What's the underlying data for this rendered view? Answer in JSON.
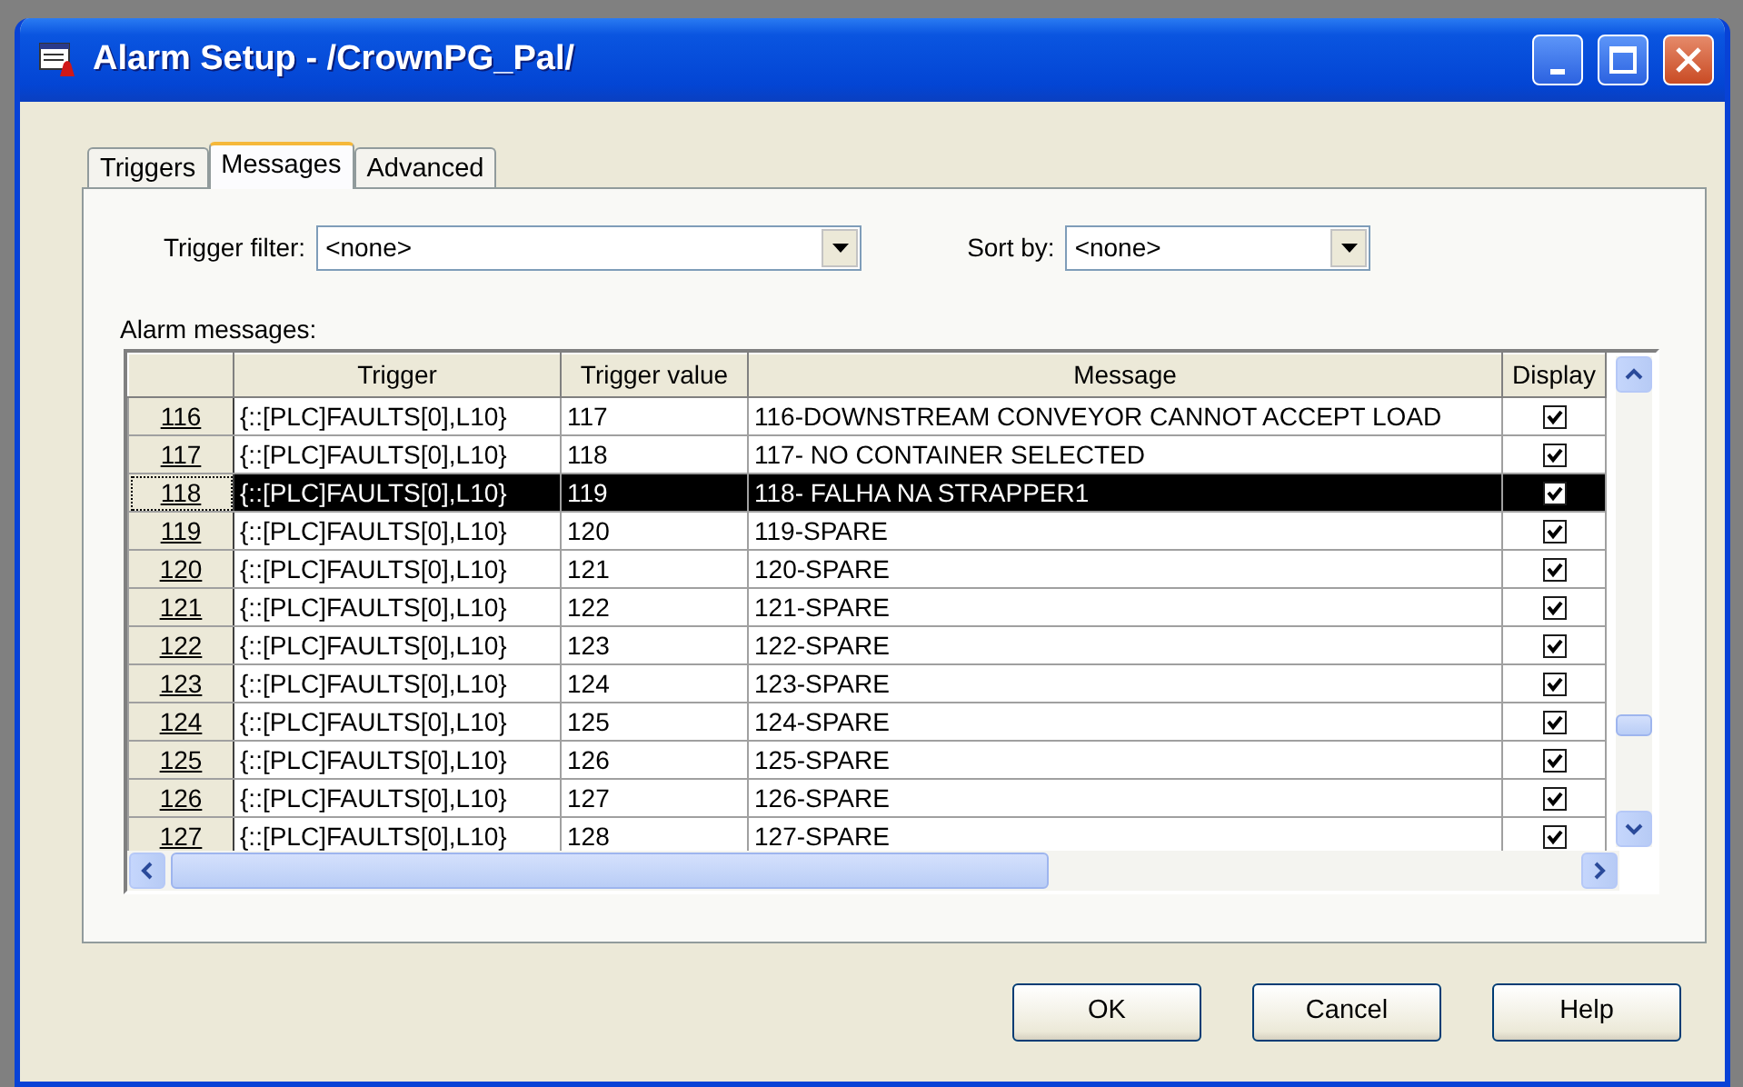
{
  "window": {
    "title": "Alarm Setup - /CrownPG_Pal/"
  },
  "tabs": [
    {
      "label": "Triggers",
      "selected": false
    },
    {
      "label": "Messages",
      "selected": true
    },
    {
      "label": "Advanced",
      "selected": false
    }
  ],
  "filters": {
    "trigger_filter": {
      "label": "Trigger filter:",
      "value": "<none>"
    },
    "sort_by": {
      "label": "Sort by:",
      "value": "<none>"
    }
  },
  "table": {
    "label": "Alarm messages:",
    "columns": [
      "Trigger",
      "Trigger value",
      "Message",
      "Display"
    ],
    "rows": [
      {
        "number": "116",
        "trigger": "{::[PLC]FAULTS[0],L10}",
        "trigger_value": "117",
        "message": "116-DOWNSTREAM CONVEYOR CANNOT ACCEPT LOAD",
        "display": true,
        "selected": false
      },
      {
        "number": "117",
        "trigger": "{::[PLC]FAULTS[0],L10}",
        "trigger_value": "118",
        "message": "117- NO CONTAINER SELECTED",
        "display": true,
        "selected": false
      },
      {
        "number": "118",
        "trigger": "{::[PLC]FAULTS[0],L10}",
        "trigger_value": "119",
        "message": "118- FALHA NA STRAPPER1",
        "display": true,
        "selected": true
      },
      {
        "number": "119",
        "trigger": "{::[PLC]FAULTS[0],L10}",
        "trigger_value": "120",
        "message": "119-SPARE",
        "display": true,
        "selected": false
      },
      {
        "number": "120",
        "trigger": "{::[PLC]FAULTS[0],L10}",
        "trigger_value": "121",
        "message": "120-SPARE",
        "display": true,
        "selected": false
      },
      {
        "number": "121",
        "trigger": "{::[PLC]FAULTS[0],L10}",
        "trigger_value": "122",
        "message": "121-SPARE",
        "display": true,
        "selected": false
      },
      {
        "number": "122",
        "trigger": "{::[PLC]FAULTS[0],L10}",
        "trigger_value": "123",
        "message": "122-SPARE",
        "display": true,
        "selected": false
      },
      {
        "number": "123",
        "trigger": "{::[PLC]FAULTS[0],L10}",
        "trigger_value": "124",
        "message": "123-SPARE",
        "display": true,
        "selected": false
      },
      {
        "number": "124",
        "trigger": "{::[PLC]FAULTS[0],L10}",
        "trigger_value": "125",
        "message": "124-SPARE",
        "display": true,
        "selected": false
      },
      {
        "number": "125",
        "trigger": "{::[PLC]FAULTS[0],L10}",
        "trigger_value": "126",
        "message": "125-SPARE",
        "display": true,
        "selected": false
      },
      {
        "number": "126",
        "trigger": "{::[PLC]FAULTS[0],L10}",
        "trigger_value": "127",
        "message": "126-SPARE",
        "display": true,
        "selected": false
      },
      {
        "number": "127",
        "trigger": "{::[PLC]FAULTS[0],L10}",
        "trigger_value": "128",
        "message": "127-SPARE",
        "display": true,
        "selected": false
      }
    ]
  },
  "buttons": [
    "OK",
    "Cancel",
    "Help"
  ]
}
